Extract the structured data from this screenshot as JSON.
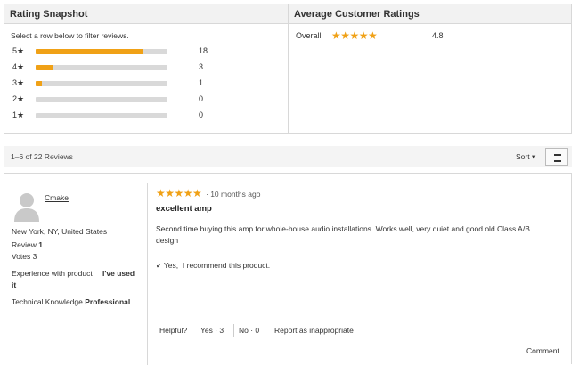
{
  "snapshot": {
    "title": "Rating Snapshot",
    "hint": "Select a row below to filter reviews.",
    "rows": [
      {
        "label": "5★",
        "count": "18",
        "fraction": 0.818
      },
      {
        "label": "4★",
        "count": "3",
        "fraction": 0.136
      },
      {
        "label": "3★",
        "count": "1",
        "fraction": 0.045
      },
      {
        "label": "2★",
        "count": "0",
        "fraction": 0
      },
      {
        "label": "1★",
        "count": "0",
        "fraction": 0
      }
    ]
  },
  "average": {
    "title": "Average Customer Ratings",
    "label": "Overall",
    "stars": "★★★★★",
    "value": "4.8"
  },
  "toolbar": {
    "count_text": "1–6 of 22 Reviews",
    "sort_label": "Sort",
    "sort_caret": "▾"
  },
  "review": {
    "author": "Cmake",
    "location": "New York, NY, United States",
    "review_label": "Review",
    "review_count": "1",
    "votes_label": "Votes",
    "votes_count": "3",
    "experience_label": "Experience with product",
    "experience_value": "I've used it",
    "knowledge_label": "Technical Knowledge",
    "knowledge_value": "Professional",
    "stars": "★★★★★",
    "time": "· 10 months ago",
    "title": "excellent amp",
    "body": "Second time buying this amp for whole-house audio installations. Works well, very quiet and good old Class A/B design",
    "recommend_icon": "✔",
    "recommend_yes": "Yes,",
    "recommend_text": "I recommend this product.",
    "helpful_label": "Helpful?",
    "yes_label": "Yes · 3",
    "no_label": "No · 0",
    "report_label": "Report as inappropriate",
    "comment_label": "Comment"
  },
  "colors": {
    "accent": "#f0a116",
    "bar_track": "#d9d9d9"
  }
}
